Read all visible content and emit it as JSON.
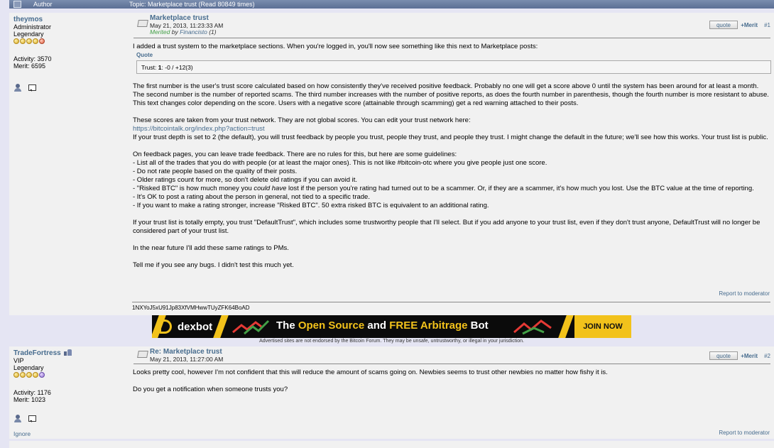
{
  "header": {
    "author_label": "Author",
    "topic_title": "Topic: Marketplace trust  (Read 80849 times)"
  },
  "post1": {
    "author": "theymos",
    "rank": "Administrator",
    "level": "Legendary",
    "activity": "Activity: 3570",
    "merit": "Merit: 6595",
    "subject": "Marketplace trust",
    "date": "May 21, 2013, 11:23:33 AM",
    "merited_label": "Merited",
    "merited_by": "by",
    "merited_who": "Financisto",
    "merited_count": "(1)",
    "quote_label": "quote",
    "merit_link": "+Merit",
    "post_num": "#1",
    "intro": "I added a trust system to the marketplace sections. When you're logged in, you'll now see something like this next to Marketplace posts:",
    "quote_header": "Quote",
    "quote_pre": "Trust: ",
    "quote_bold": "1",
    "quote_post": ": -0 / +12(3)",
    "para1": "The first number is the user's trust score calculated based on how consistently they've received positive feedback. Probably no one will get a score above 0 until the system has been around for at least a month. The second number is the number of reported scams. The third number increases with the number of positive reports, as does the fourth number in parenthesis, though the fourth number is more resistant to abuse. This text changes color depending on the score. Users with a negative score (attainable through scamming) get a red warning attached to their posts.",
    "para2": "These scores are taken from your trust network. They are not global scores. You can edit your trust network here:",
    "link": "https://bitcointalk.org/index.php?action=trust",
    "para3": "If your trust depth is set to 2 (the default), you will trust feedback by people you trust, people they trust, and people they trust. I might change the default in the future; we'll see how this works. Your trust list is public.",
    "para4": "On feedback pages, you can leave trade feedback. There are no rules for this, but here are some guidelines:",
    "g1": "- List all of the trades that you do with people (or at least the major ones). This is not like #bitcoin-otc where you give people just one score.",
    "g2": "- Do not rate people based on the quality of their posts.",
    "g3": "- Older ratings count for more, so don't delete old ratings if you can avoid it.",
    "g4_pre": "- \"Risked BTC\" is how much money you ",
    "g4_em": "could have",
    "g4_post": " lost if the person you're rating had turned out to be a scammer. Or, if they are a scammer, it's how much you lost. Use the BTC value at the time of reporting.",
    "g5": "- It's OK to post a rating about the person in general, not tied to a specific trade.",
    "g6": "- If you want to make a rating stronger, increase \"Risked BTC\". 50 extra risked BTC is equivalent to an additional rating.",
    "para5": "If your trust list is totally empty, you trust \"DefaultTrust\", which includes some trustworthy people that I'll select. But if you add anyone to your trust list, even if they don't trust anyone, DefaultTrust will no longer be considered part of your trust list.",
    "para6": "In the near future I'll add these same ratings to PMs.",
    "para7": "Tell me if you see any bugs. I didn't test this much yet.",
    "report": "Report to moderator",
    "signature": "1NXYoJ5xU91Jp83XfVMHwwTUyZFK64BoAD"
  },
  "ad": {
    "brand": "dexbot",
    "tag_1": "The ",
    "tag_2": "Open Source",
    "tag_3": " and ",
    "tag_4": "FREE Arbitrage",
    "tag_5": " Bot",
    "cta": "JOIN NOW",
    "disclaimer": "Advertised sites are not endorsed by the Bitcoin Forum. They may be unsafe, untrustworthy, or illegal in your jurisdiction."
  },
  "post2": {
    "author": "TradeFortress",
    "rank": "VIP",
    "level": "Legendary",
    "activity": "Activity: 1176",
    "merit": "Merit: 1023",
    "subject": "Re: Marketplace trust",
    "date": "May 21, 2013, 11:27:00 AM",
    "quote_label": "quote",
    "merit_link": "+Merit",
    "post_num": "#2",
    "para1": "Looks pretty cool, however I'm not confident that this will reduce the amount of scams going on. Newbies seems to trust other newbies no matter how fishy it is.",
    "para2": "Do you get a notification when someone trusts you?",
    "ignore": "Ignore",
    "report": "Report to moderator"
  },
  "colors": {
    "link": "#476c8e",
    "header_bar": "#5b6f95",
    "post_bg": "#f1f1f1",
    "page_bg": "#e5e5f3",
    "ad_accent": "#f2c21b",
    "merited": "#43a047"
  }
}
